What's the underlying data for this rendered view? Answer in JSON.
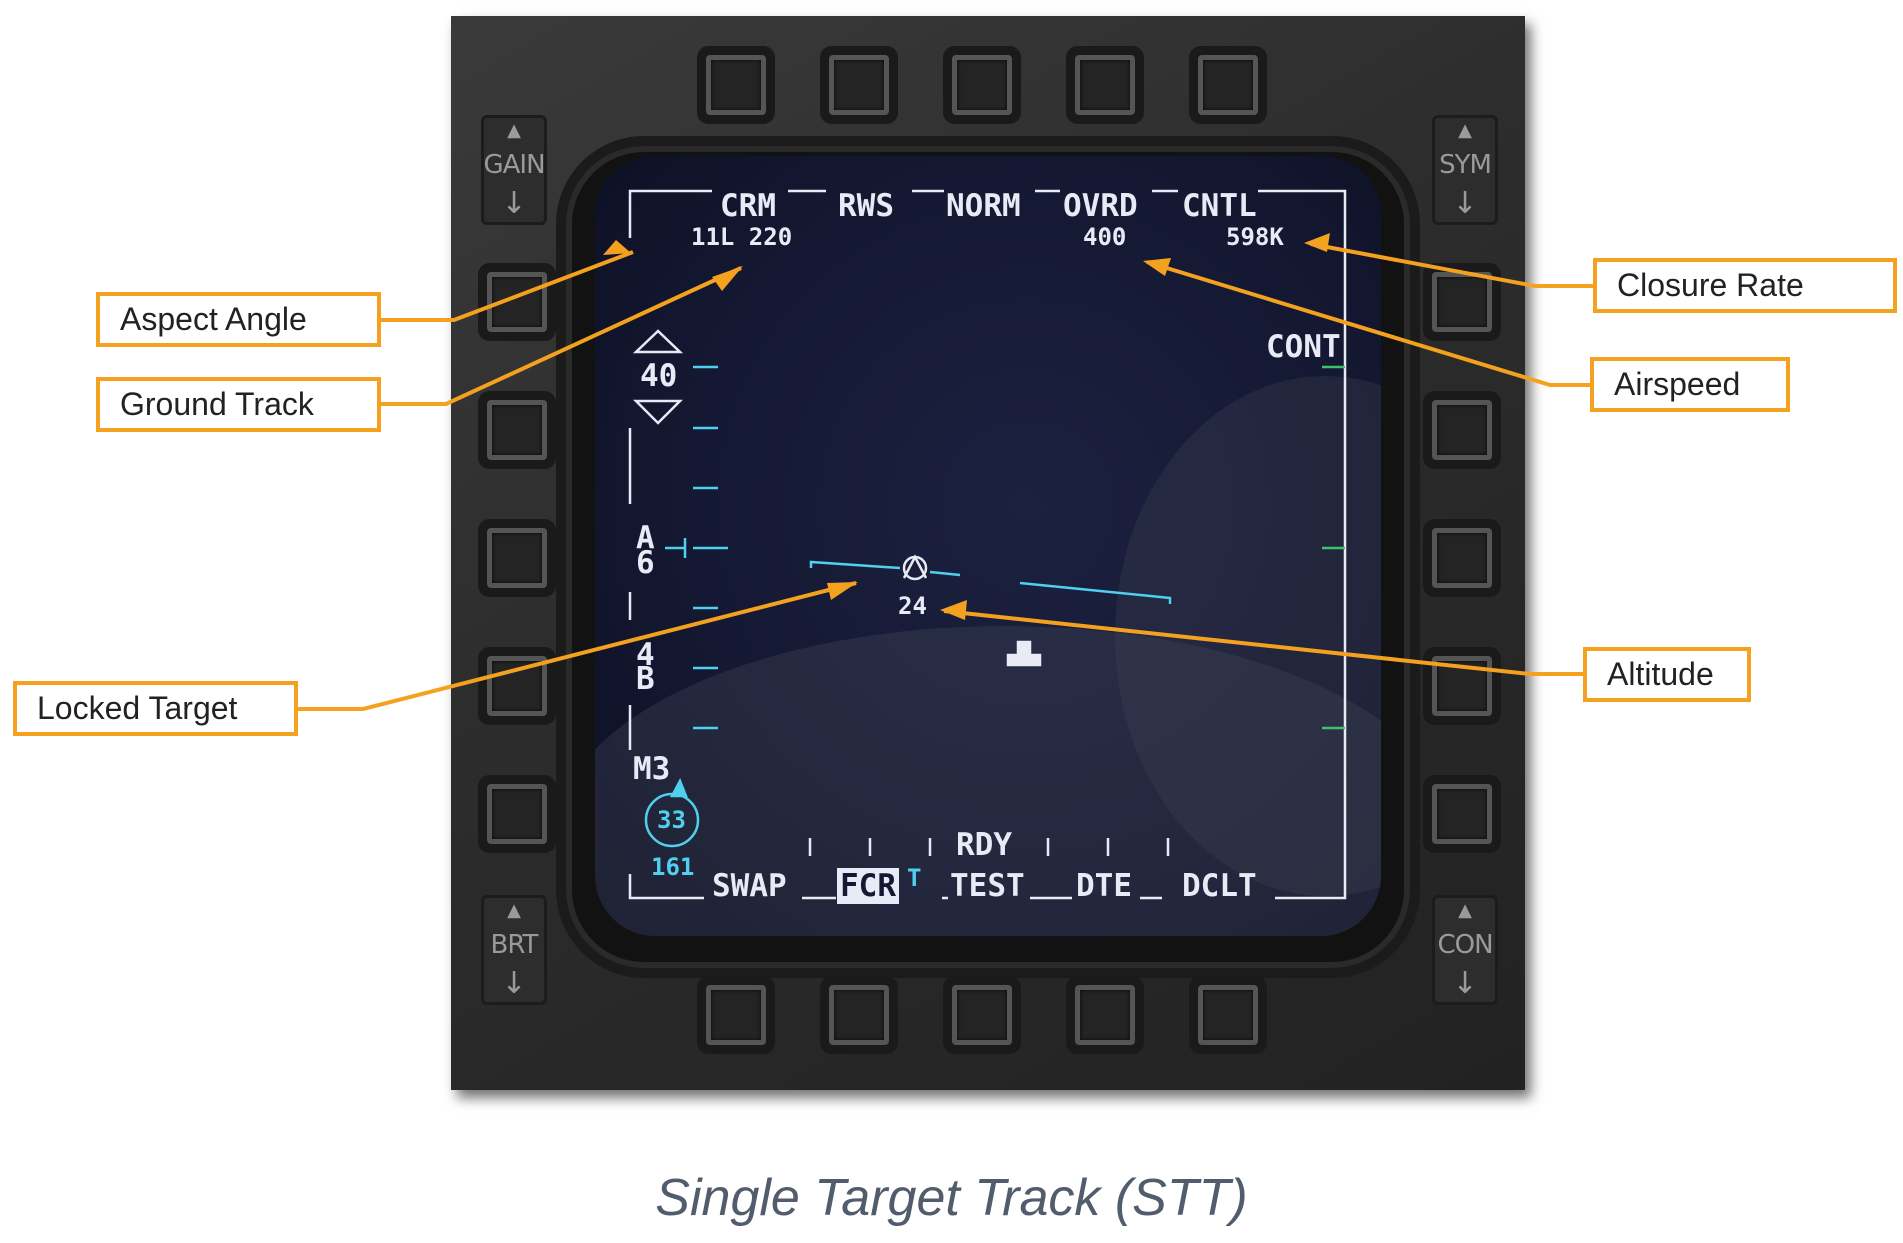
{
  "mfd": {
    "rockers": {
      "gain": "GAIN",
      "sym": "SYM",
      "brt": "BRT",
      "con": "CON"
    },
    "top_labels": [
      "CRM",
      "RWS",
      "NORM",
      "OVRD",
      "CNTL"
    ],
    "aspect_ground_track": "11L 220",
    "airspeed": "400",
    "closure_rate": "598K",
    "cont": "CONT",
    "scale_value": "40",
    "azimuth": {
      "letter_a": "A",
      "digit_6": "6",
      "digit_4": "4",
      "letter_b": "B"
    },
    "bar_code": "M3",
    "bullseye_bearing": "33",
    "bullseye_range": "161",
    "target_altitude": "24",
    "rdy": "RDY",
    "bottom_labels": {
      "swap": "SWAP",
      "fcr": "FCR",
      "fcr_marker": "T",
      "test": "TEST",
      "dte": "DTE",
      "dclt": "DCLT"
    },
    "colors": {
      "symbology": "#e8ebf5",
      "cyan": "#4fd0ee",
      "green_ticks": "#3fc06a"
    }
  },
  "callouts": {
    "aspect_angle": "Aspect Angle",
    "ground_track": "Ground Track",
    "locked_target": "Locked Target",
    "closure_rate": "Closure Rate",
    "airspeed": "Airspeed",
    "altitude": "Altitude",
    "line_color": "#f4a11f"
  },
  "caption": "Single Target Track (STT)"
}
